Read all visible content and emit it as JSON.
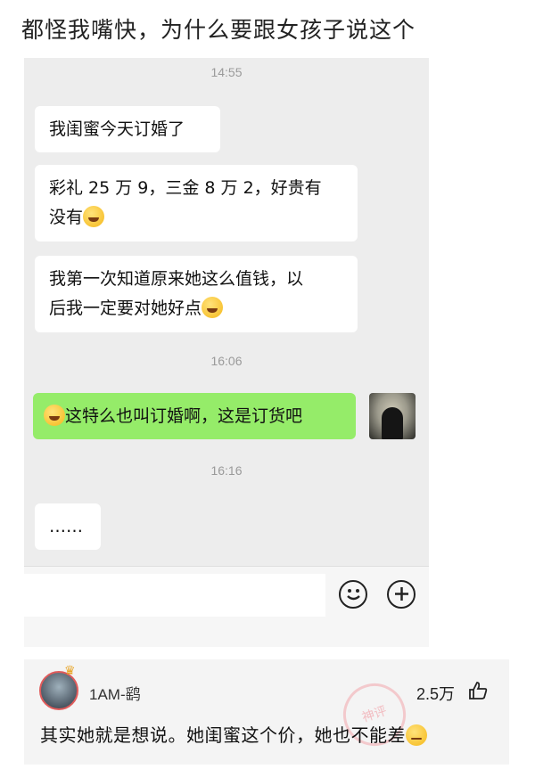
{
  "post": {
    "title": "都怪我嘴快，为什么要跟女孩子说这个"
  },
  "chat": {
    "time1": "14:55",
    "msg1": "我闺蜜今天订婚了",
    "msg2_line1": "彩礼 25 万 9，三金 8 万 2，好贵有",
    "msg2_line2": "没有",
    "msg3_line1": "我第一次知道原来她这么值钱，以",
    "msg3_line2": "后我一定要对她好点",
    "time2": "16:06",
    "msg4": "这特么也叫订婚啊，这是订货吧",
    "time3": "16:16",
    "msg5": "……"
  },
  "comment": {
    "username": "1AM-鹞",
    "likes": "2.5万",
    "text": "其实她就是想说。她闺蜜这个价，她也不能差",
    "stamp": "神评"
  },
  "icons": {
    "emoji_laugh": "laugh-cry-emoji",
    "emoji_roll": "eye-roll-emoji",
    "emoji_button": "smiley-face-icon",
    "plus_button": "plus-circle-icon",
    "thumb": "thumbs-up-icon",
    "crown": "crown-icon"
  },
  "colors": {
    "chat_bg": "#ededed",
    "my_bubble": "#95ec69",
    "accent_red": "#e05b5b"
  }
}
